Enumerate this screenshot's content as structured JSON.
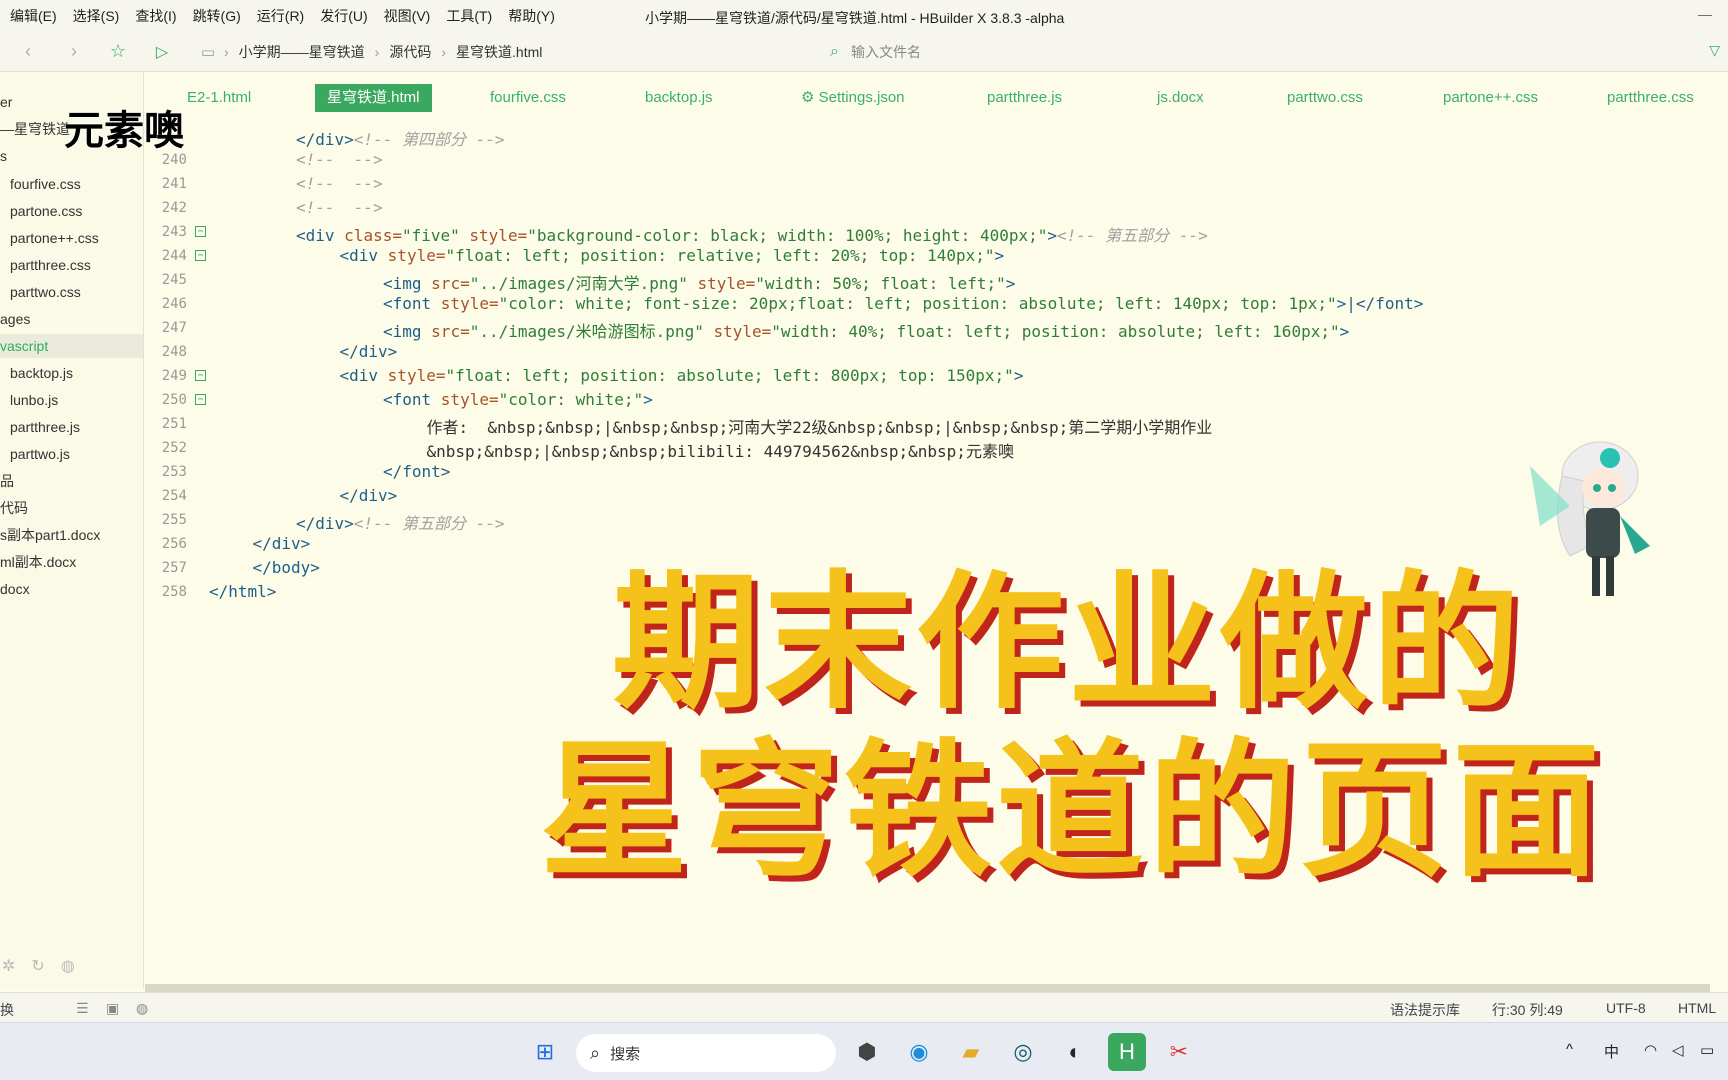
{
  "menubar": {
    "items": [
      "编辑(E)",
      "选择(S)",
      "查找(I)",
      "跳转(G)",
      "运行(R)",
      "发行(U)",
      "视图(V)",
      "工具(T)",
      "帮助(Y)"
    ],
    "window_title": "小学期——星穹铁道/源代码/星穹铁道.html - HBuilder X 3.8.3 -alpha",
    "minimize_glyph": "—"
  },
  "toolbar": {
    "breadcrumb": [
      "小学期——星穹铁道",
      "源代码",
      "星穹铁道.html"
    ],
    "file_search_placeholder": "输入文件名"
  },
  "sidebar": {
    "items": [
      {
        "label": "er",
        "indent": 0
      },
      {
        "label": "—星穹铁道",
        "indent": 0
      },
      {
        "label": "s",
        "indent": 0
      },
      {
        "label": "fourfive.css",
        "indent": 1
      },
      {
        "label": "partone.css",
        "indent": 1
      },
      {
        "label": "partone++.css",
        "indent": 1
      },
      {
        "label": "partthree.css",
        "indent": 1
      },
      {
        "label": "parttwo.css",
        "indent": 1
      },
      {
        "label": "ages",
        "indent": 0
      },
      {
        "label": "vascript",
        "indent": 0,
        "active": true
      },
      {
        "label": "backtop.js",
        "indent": 1
      },
      {
        "label": "lunbo.js",
        "indent": 1
      },
      {
        "label": "partthree.js",
        "indent": 1
      },
      {
        "label": "parttwo.js",
        "indent": 1
      },
      {
        "label": "品",
        "indent": 0
      },
      {
        "label": "代码",
        "indent": 0
      },
      {
        "label": "s副本part1.docx",
        "indent": 0
      },
      {
        "label": "ml副本.docx",
        "indent": 0
      },
      {
        "label": "docx",
        "indent": 0
      }
    ]
  },
  "tabs": [
    {
      "label": "E2-1.html",
      "active": false
    },
    {
      "label": "星穹铁道.html",
      "active": true
    },
    {
      "label": "fourfive.css",
      "active": false
    },
    {
      "label": "backtop.js",
      "active": false
    },
    {
      "label": "⚙ Settings.json",
      "active": false
    },
    {
      "label": "partthree.js",
      "active": false
    },
    {
      "label": "js.docx",
      "active": false
    },
    {
      "label": "parttwo.css",
      "active": false
    },
    {
      "label": "partone++.css",
      "active": false
    },
    {
      "label": "partthree.css",
      "active": false
    }
  ],
  "editor": {
    "lines": [
      {
        "num": "",
        "fold": false,
        "indent": 2,
        "segments": [
          [
            "tag",
            "</div>"
          ],
          [
            "cmt",
            "<!-- 第四部分 -->"
          ]
        ]
      },
      {
        "num": "240",
        "fold": false,
        "indent": 2,
        "segments": [
          [
            "cmt",
            "<!--  -->"
          ]
        ]
      },
      {
        "num": "241",
        "fold": false,
        "indent": 2,
        "segments": [
          [
            "cmt",
            "<!--  -->"
          ]
        ]
      },
      {
        "num": "242",
        "fold": false,
        "indent": 2,
        "segments": [
          [
            "cmt",
            "<!--  -->"
          ]
        ]
      },
      {
        "num": "243",
        "fold": true,
        "indent": 2,
        "segments": [
          [
            "tag",
            "<div "
          ],
          [
            "attr",
            "class="
          ],
          [
            "str",
            "\"five\" "
          ],
          [
            "attr",
            "style="
          ],
          [
            "str",
            "\"background-color: black; width: 100%; height: 400px;\""
          ],
          [
            "tag",
            ">"
          ],
          [
            "cmt",
            "<!-- 第五部分 -->"
          ]
        ]
      },
      {
        "num": "244",
        "fold": true,
        "indent": 3,
        "segments": [
          [
            "tag",
            "<div "
          ],
          [
            "attr",
            "style="
          ],
          [
            "str",
            "\"float: left; position: relative; left: 20%; top: 140px;\""
          ],
          [
            "tag",
            ">"
          ]
        ]
      },
      {
        "num": "245",
        "fold": false,
        "indent": 4,
        "segments": [
          [
            "tag",
            "<img "
          ],
          [
            "attr",
            "src="
          ],
          [
            "str",
            "\"../images/河南大学.png\" "
          ],
          [
            "attr",
            "style="
          ],
          [
            "str",
            "\"width: 50%; float: left;\""
          ],
          [
            "tag",
            ">"
          ]
        ]
      },
      {
        "num": "246",
        "fold": false,
        "indent": 4,
        "segments": [
          [
            "tag",
            "<font "
          ],
          [
            "attr",
            "style="
          ],
          [
            "str",
            "\"color: white; font-size: 20px;float: left; position: absolute; left: 140px; top: 1px;\""
          ],
          [
            "tag",
            ">|</font>"
          ]
        ]
      },
      {
        "num": "247",
        "fold": false,
        "indent": 4,
        "segments": [
          [
            "tag",
            "<img "
          ],
          [
            "attr",
            "src="
          ],
          [
            "str",
            "\"../images/米哈游图标.png\" "
          ],
          [
            "attr",
            "style="
          ],
          [
            "str",
            "\"width: 40%; float: left; position: absolute; left: 160px;\""
          ],
          [
            "tag",
            ">"
          ]
        ]
      },
      {
        "num": "248",
        "fold": false,
        "indent": 3,
        "segments": [
          [
            "tag",
            "</div>"
          ]
        ]
      },
      {
        "num": "249",
        "fold": true,
        "indent": 3,
        "segments": [
          [
            "tag",
            "<div "
          ],
          [
            "attr",
            "style="
          ],
          [
            "str",
            "\"float: left; position: absolute; left: 800px; top: 150px;\""
          ],
          [
            "tag",
            ">"
          ]
        ]
      },
      {
        "num": "250",
        "fold": true,
        "indent": 4,
        "segments": [
          [
            "tag",
            "<font "
          ],
          [
            "attr",
            "style="
          ],
          [
            "str",
            "\"color: white;\""
          ],
          [
            "tag",
            ">"
          ]
        ]
      },
      {
        "num": "251",
        "fold": false,
        "indent": 5,
        "segments": [
          [
            "txt",
            "作者:  &nbsp;&nbsp;|&nbsp;&nbsp;河南大学22级&nbsp;&nbsp;|&nbsp;&nbsp;第二学期小学期作业"
          ]
        ]
      },
      {
        "num": "252",
        "fold": false,
        "indent": 5,
        "segments": [
          [
            "txt",
            "&nbsp;&nbsp;|&nbsp;&nbsp;bilibili: 449794562&nbsp;&nbsp;元素噢"
          ]
        ]
      },
      {
        "num": "253",
        "fold": false,
        "indent": 4,
        "segments": [
          [
            "tag",
            "</font>"
          ]
        ]
      },
      {
        "num": "254",
        "fold": false,
        "indent": 3,
        "segments": [
          [
            "tag",
            "</div>"
          ]
        ]
      },
      {
        "num": "255",
        "fold": false,
        "indent": 2,
        "segments": [
          [
            "tag",
            "</div>"
          ],
          [
            "cmt",
            "<!-- 第五部分 -->"
          ]
        ]
      },
      {
        "num": "256",
        "fold": false,
        "indent": 1,
        "segments": [
          [
            "tag",
            "</div>"
          ]
        ]
      },
      {
        "num": "257",
        "fold": false,
        "indent": 1,
        "segments": [
          [
            "tag",
            "</body>"
          ]
        ]
      },
      {
        "num": "258",
        "fold": false,
        "indent": 0,
        "segments": [
          [
            "tag",
            "</html>"
          ]
        ]
      }
    ]
  },
  "overlay": {
    "watermark": "元素噢",
    "banner_line1": "期末作业做的",
    "banner_line2": "星穹铁道的页面"
  },
  "statusbar": {
    "left_text": "换",
    "syntax_hint": "语法提示库",
    "position": "行:30  列:49",
    "encoding": "UTF-8",
    "language": "HTML"
  },
  "taskbar": {
    "search_label": "搜索",
    "ime": "中"
  },
  "colors": {
    "accent_green": "#3aa95f",
    "banner_yellow": "#f4c21a",
    "banner_red_shadow": "#c0241b",
    "editor_bg": "#fdfce8"
  }
}
